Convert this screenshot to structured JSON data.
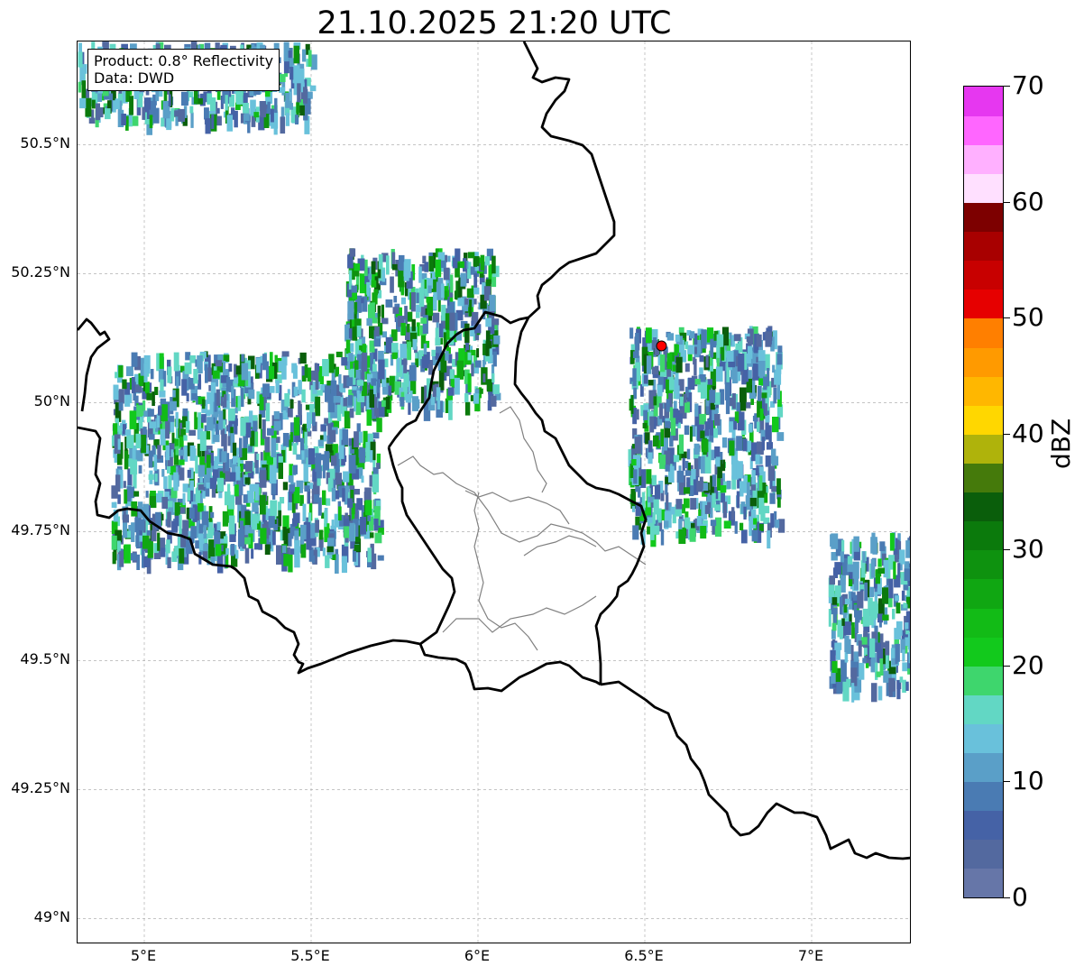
{
  "title": "21.10.2025 21:20 UTC",
  "info": {
    "product": "Product: 0.8° Reflectivity",
    "data": "Data: DWD"
  },
  "axes": {
    "x_ticks": [
      "5°E",
      "5.5°E",
      "6°E",
      "6.5°E",
      "7°E"
    ],
    "y_ticks": [
      "50.5°N",
      "50.25°N",
      "50°N",
      "49.75°N",
      "49.5°N",
      "49.25°N",
      "49°N"
    ],
    "lon_range": [
      4.8,
      7.3
    ],
    "lat_range": [
      48.95,
      50.7
    ],
    "grid": true
  },
  "colorbar": {
    "label": "dBZ",
    "ticks": [
      "0",
      "10",
      "20",
      "30",
      "40",
      "50",
      "60",
      "70"
    ],
    "range": [
      0,
      70
    ],
    "colors": [
      "#6676a8",
      "#53699f",
      "#4562a6",
      "#4a7bb3",
      "#5a9fc8",
      "#69c1db",
      "#62d7c4",
      "#3ed66d",
      "#12c91c",
      "#12bb16",
      "#10a712",
      "#0e920f",
      "#0b7a0c",
      "#0a5e0b",
      "#457a0b",
      "#afb30b",
      "#ffd700",
      "#ffb700",
      "#ff9a00",
      "#ff7f00",
      "#e60000",
      "#c80000",
      "#a80000",
      "#7d0000",
      "#ffe0ff",
      "#ffb0ff",
      "#ff66ff",
      "#e637f0"
    ]
  },
  "marker": {
    "lon": 6.55,
    "lat": 50.11,
    "color": "#ff0000"
  },
  "echo_regions": [
    {
      "name": "northwest-corner band",
      "lon": [
        4.8,
        5.5
      ],
      "lat": [
        50.55,
        50.7
      ],
      "max_dbz": 25
    },
    {
      "name": "central belgium cluster",
      "lon": [
        5.6,
        6.05
      ],
      "lat": [
        50.0,
        50.3
      ],
      "max_dbz": 33
    },
    {
      "name": "western scattered bands",
      "lon": [
        4.9,
        5.7
      ],
      "lat": [
        49.7,
        50.1
      ],
      "max_dbz": 28
    },
    {
      "name": "eifel echoes",
      "lon": [
        6.45,
        6.9
      ],
      "lat": [
        49.75,
        50.15
      ],
      "max_dbz": 25
    },
    {
      "name": "saarland-east cluster",
      "lon": [
        7.05,
        7.3
      ],
      "lat": [
        49.45,
        49.75
      ],
      "max_dbz": 24
    }
  ]
}
